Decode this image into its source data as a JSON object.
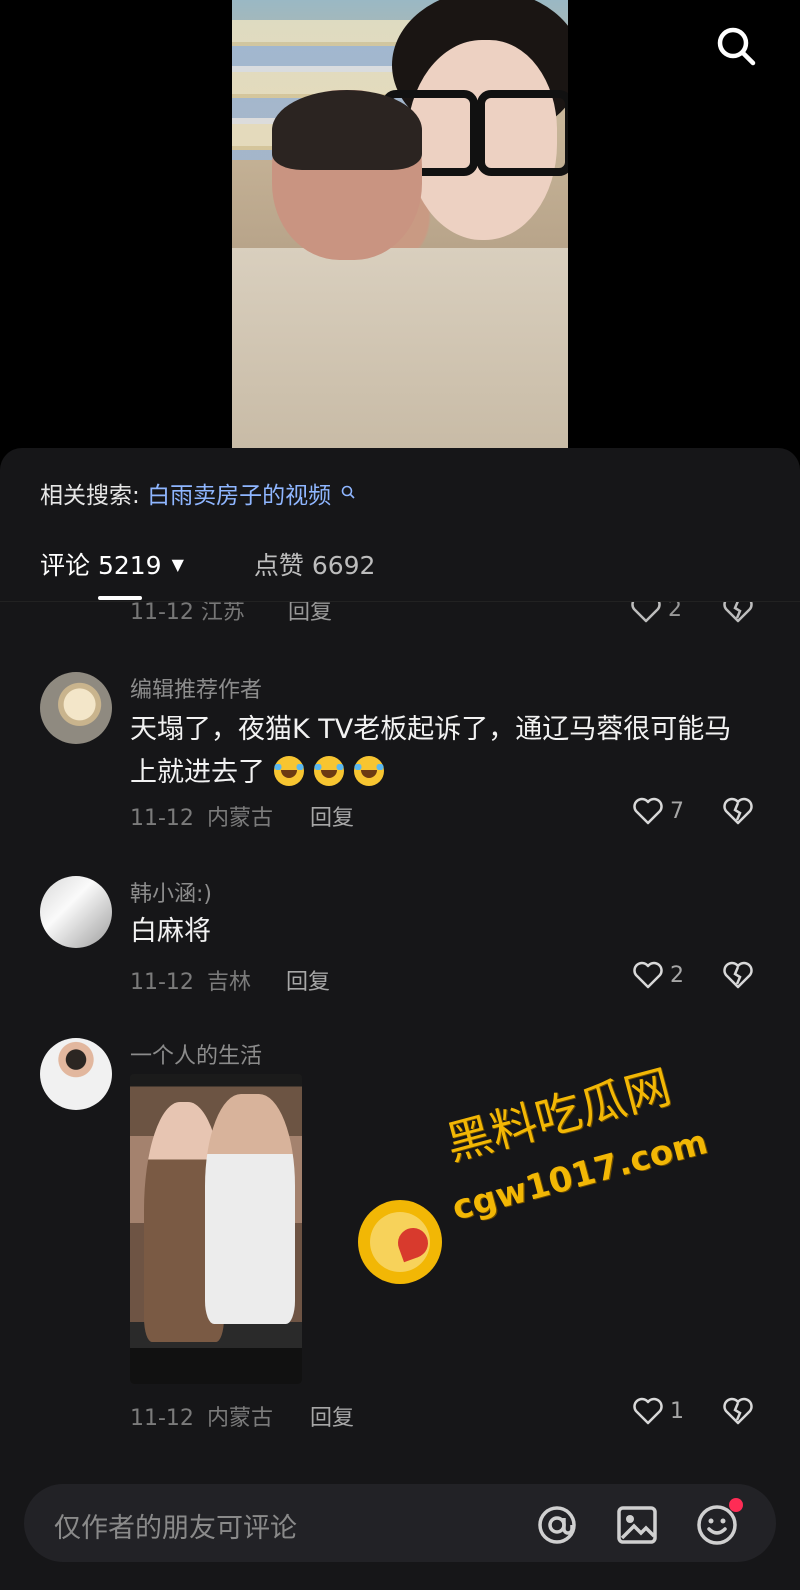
{
  "header": {
    "search_icon": "search-icon"
  },
  "panel": {
    "related_label": "相关搜索:",
    "related_query": "白雨卖房子的视频",
    "tabs": {
      "comments_label": "评论 5219",
      "comments_caret": "▼",
      "likes_label": "点赞 6692"
    },
    "cut_comment": {
      "meta": "11-12 江苏",
      "reply": "回复",
      "likes": "2"
    },
    "comments": [
      {
        "username": "编辑推荐作者",
        "text": "天塌了，夜猫K TV老板起诉了，通辽马蓉很可能马上就进去了",
        "emojis": [
          "😂",
          "😂",
          "😂"
        ],
        "date": "11-12",
        "location": "内蒙古",
        "reply": "回复",
        "likes": "7"
      },
      {
        "username": "韩小涵:)",
        "text": "白麻将",
        "date": "11-12",
        "location": "吉林",
        "reply": "回复",
        "likes": "2"
      },
      {
        "username": "一个人的生活",
        "text": "",
        "date": "11-12",
        "location": "内蒙古",
        "reply": "回复",
        "likes": "1"
      }
    ]
  },
  "watermark": {
    "cn": "黑料吃瓜网",
    "url": "cgw1017.com"
  },
  "bottom_bar": {
    "placeholder": "仅作者的朋友可评论",
    "icons": [
      "at-icon",
      "image-icon",
      "emoji-icon"
    ]
  },
  "colors": {
    "background": "#000000",
    "panel": "#161618",
    "link": "#8fb6ff",
    "watermark": "#f2b705",
    "notify": "#fe2c55"
  }
}
